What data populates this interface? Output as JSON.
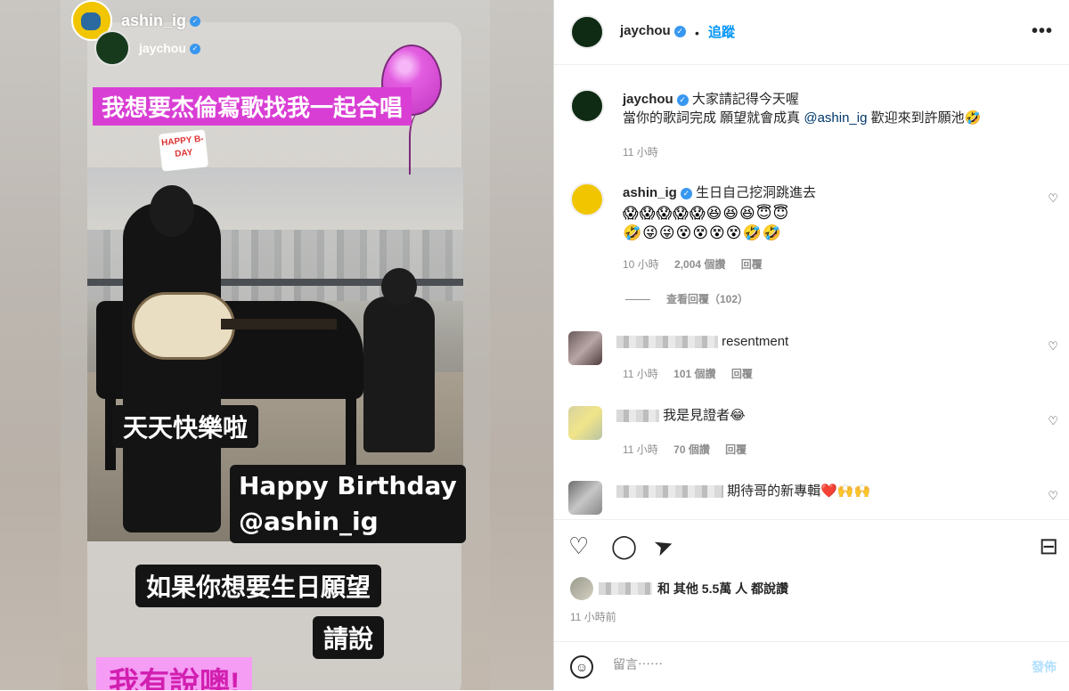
{
  "story": {
    "reposter": "ashin_ig",
    "original_author": "jaychou",
    "hat_text": "HAPPY B-DAY",
    "caption_top": "我想要杰倫寫歌找我一起合唱",
    "caption_1": "天天快樂啦",
    "caption_2_line1": "Happy Birthday",
    "caption_2_line2": "@ashin_ig",
    "caption_3": "如果你想要生日願望",
    "caption_4": "請說",
    "caption_5": "我有說噢!"
  },
  "header": {
    "username": "jaychou",
    "verified": "✓",
    "separator": "•",
    "follow_label": "追蹤",
    "more_label": "•••"
  },
  "caption": {
    "username": "jaychou",
    "line1": "大家請記得今天喔",
    "line2_prefix": "當你的歌詞完成 願望就會成真 ",
    "mention": "@ashin_ig",
    "line2_suffix": " 歡迎來到許願池🤣",
    "time": "11 小時"
  },
  "comments": [
    {
      "username": "ashin_ig",
      "text": "生日自己挖洞跳進去",
      "emojis_line1": "😱😱😱😱😱😆😆😆😇😇",
      "emojis_line2": "🤣😜😜😵😵😵😵🤣🤣",
      "time": "10 小時",
      "likes": "2,004 個讚",
      "reply": "回覆",
      "view_replies": "查看回覆（102）"
    },
    {
      "text": "resentment",
      "time": "11 小時",
      "likes": "101 個讚",
      "reply": "回覆"
    },
    {
      "text": "我是見證者😂",
      "time": "11 小時",
      "likes": "70 個讚",
      "reply": "回覆"
    },
    {
      "text": "期待哥的新專輯❤️🙌🙌"
    }
  ],
  "actions": {
    "like_icon": "♡",
    "comment_icon": "◯",
    "share_icon": "➤",
    "save_icon": "⊟"
  },
  "likes_summary": "和 其他 5.5萬 人 都說讚",
  "post_time": "11 小時前",
  "comment_box": {
    "emoji_icon": "☺",
    "placeholder": "留言⋯⋯",
    "post_label": "發佈"
  },
  "colors": {
    "accent": "#0095f6",
    "verified": "#3897f0",
    "sticker_pink": "#d93ed4"
  }
}
